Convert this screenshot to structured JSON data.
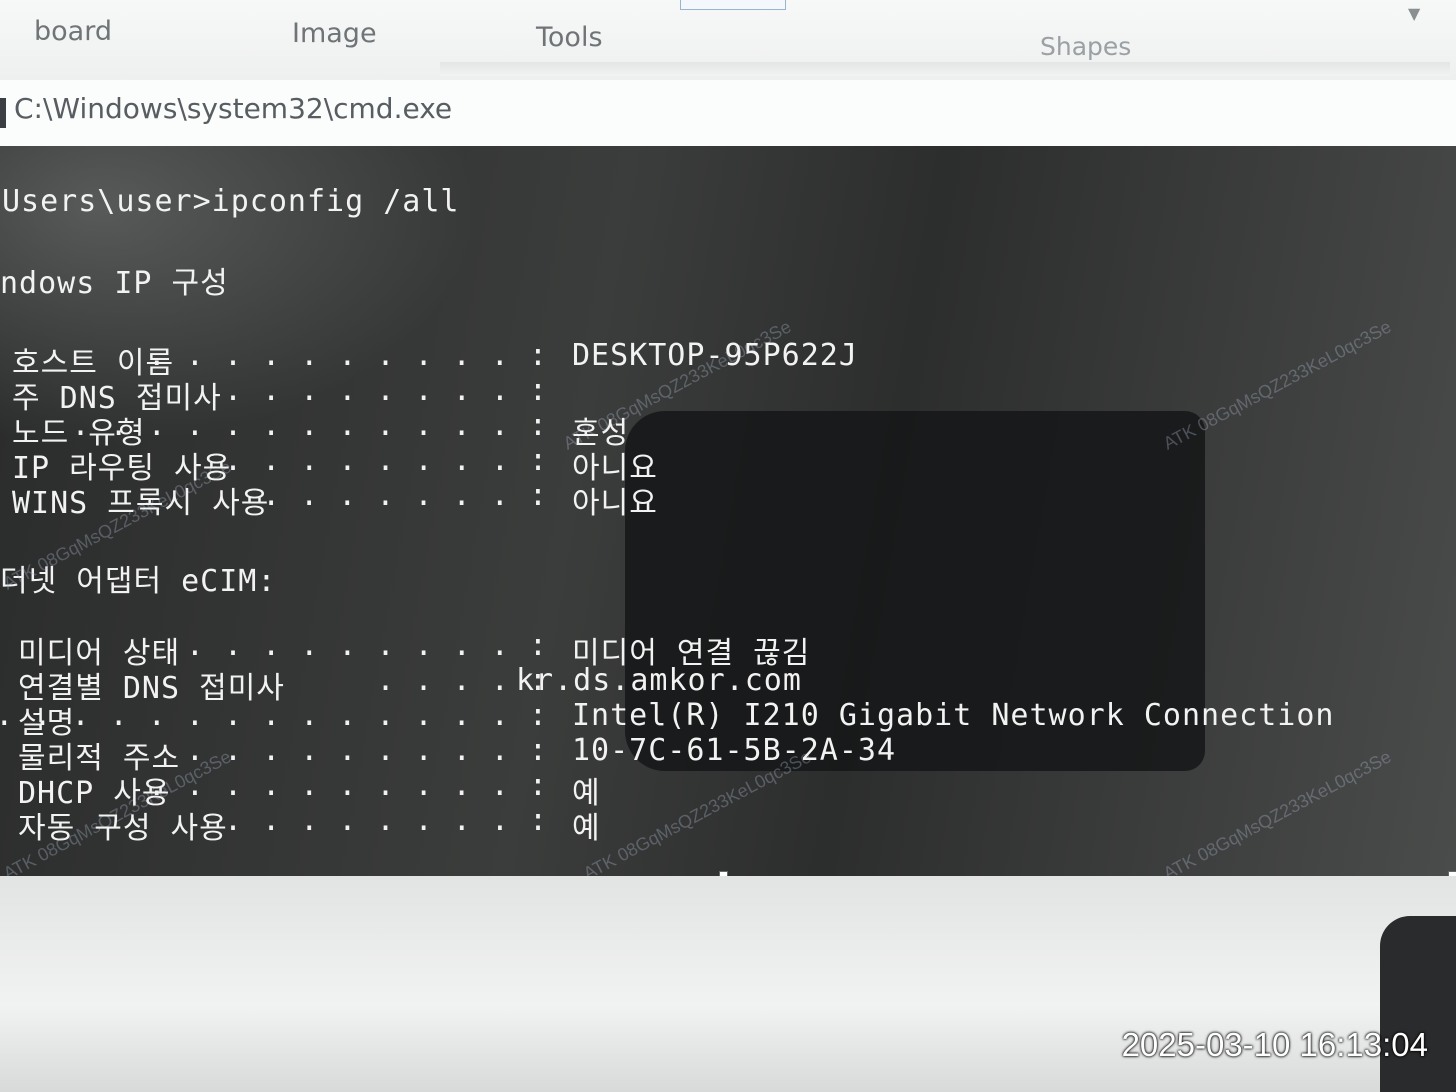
{
  "ribbon": {
    "tabs": [
      "board",
      "Image",
      "Tools",
      "Shapes"
    ]
  },
  "window": {
    "title": "C:\\Windows\\system32\\cmd.exe"
  },
  "console": {
    "command": "Users\\user>ipconfig /all",
    "heading": "ndows IP 구성",
    "host_rows": [
      {
        "label": "호스트 이름",
        "dots": " . . . . . . . . . . :",
        "value": "DESKTOP-95P622J"
      },
      {
        "label": "주 DNS 접미사",
        "dots": " . . . . . . . . :",
        "value": ""
      },
      {
        "label": "노드 유형",
        "dots": " . . . . . . . . . . . . :",
        "value": "혼성"
      },
      {
        "label": "IP 라우팅 사용",
        "dots": ". . . . . . . . :",
        "value": "아니요"
      },
      {
        "label": "WINS 프록시 사용",
        "dots": ". . . . . . . :",
        "value": "아니요"
      }
    ],
    "adapter_heading": "더넷 어댑터 eCIM:",
    "adapter_rows": [
      {
        "label": "미디어 상태",
        "dots": " . . . . . . . . . :",
        "value": "미디어 연결 끊김"
      },
      {
        "label": "연결별 DNS 접미사",
        "dots": ". . . . :",
        "value": "kr.ds.amkor.com"
      },
      {
        "label": "설명",
        "dots": ". . . . . . . . . . . . . . :",
        "value": "Intel(R) I210 Gigabit Network Connection"
      },
      {
        "label": "물리적 주소",
        "dots": " . . . . . . . . . :",
        "value": "10-7C-61-5B-2A-34"
      },
      {
        "label": "DHCP 사용",
        "dots": " . . . . . . . . . . :",
        "value": "예"
      },
      {
        "label": "자동 구성 사용",
        "dots": ". . . . . . . . :",
        "value": "예"
      }
    ]
  },
  "watermark_text": "ATK 08GqMsQZ233KeL0qc3Se",
  "timestamp": "2025-03-10 16:13:04"
}
